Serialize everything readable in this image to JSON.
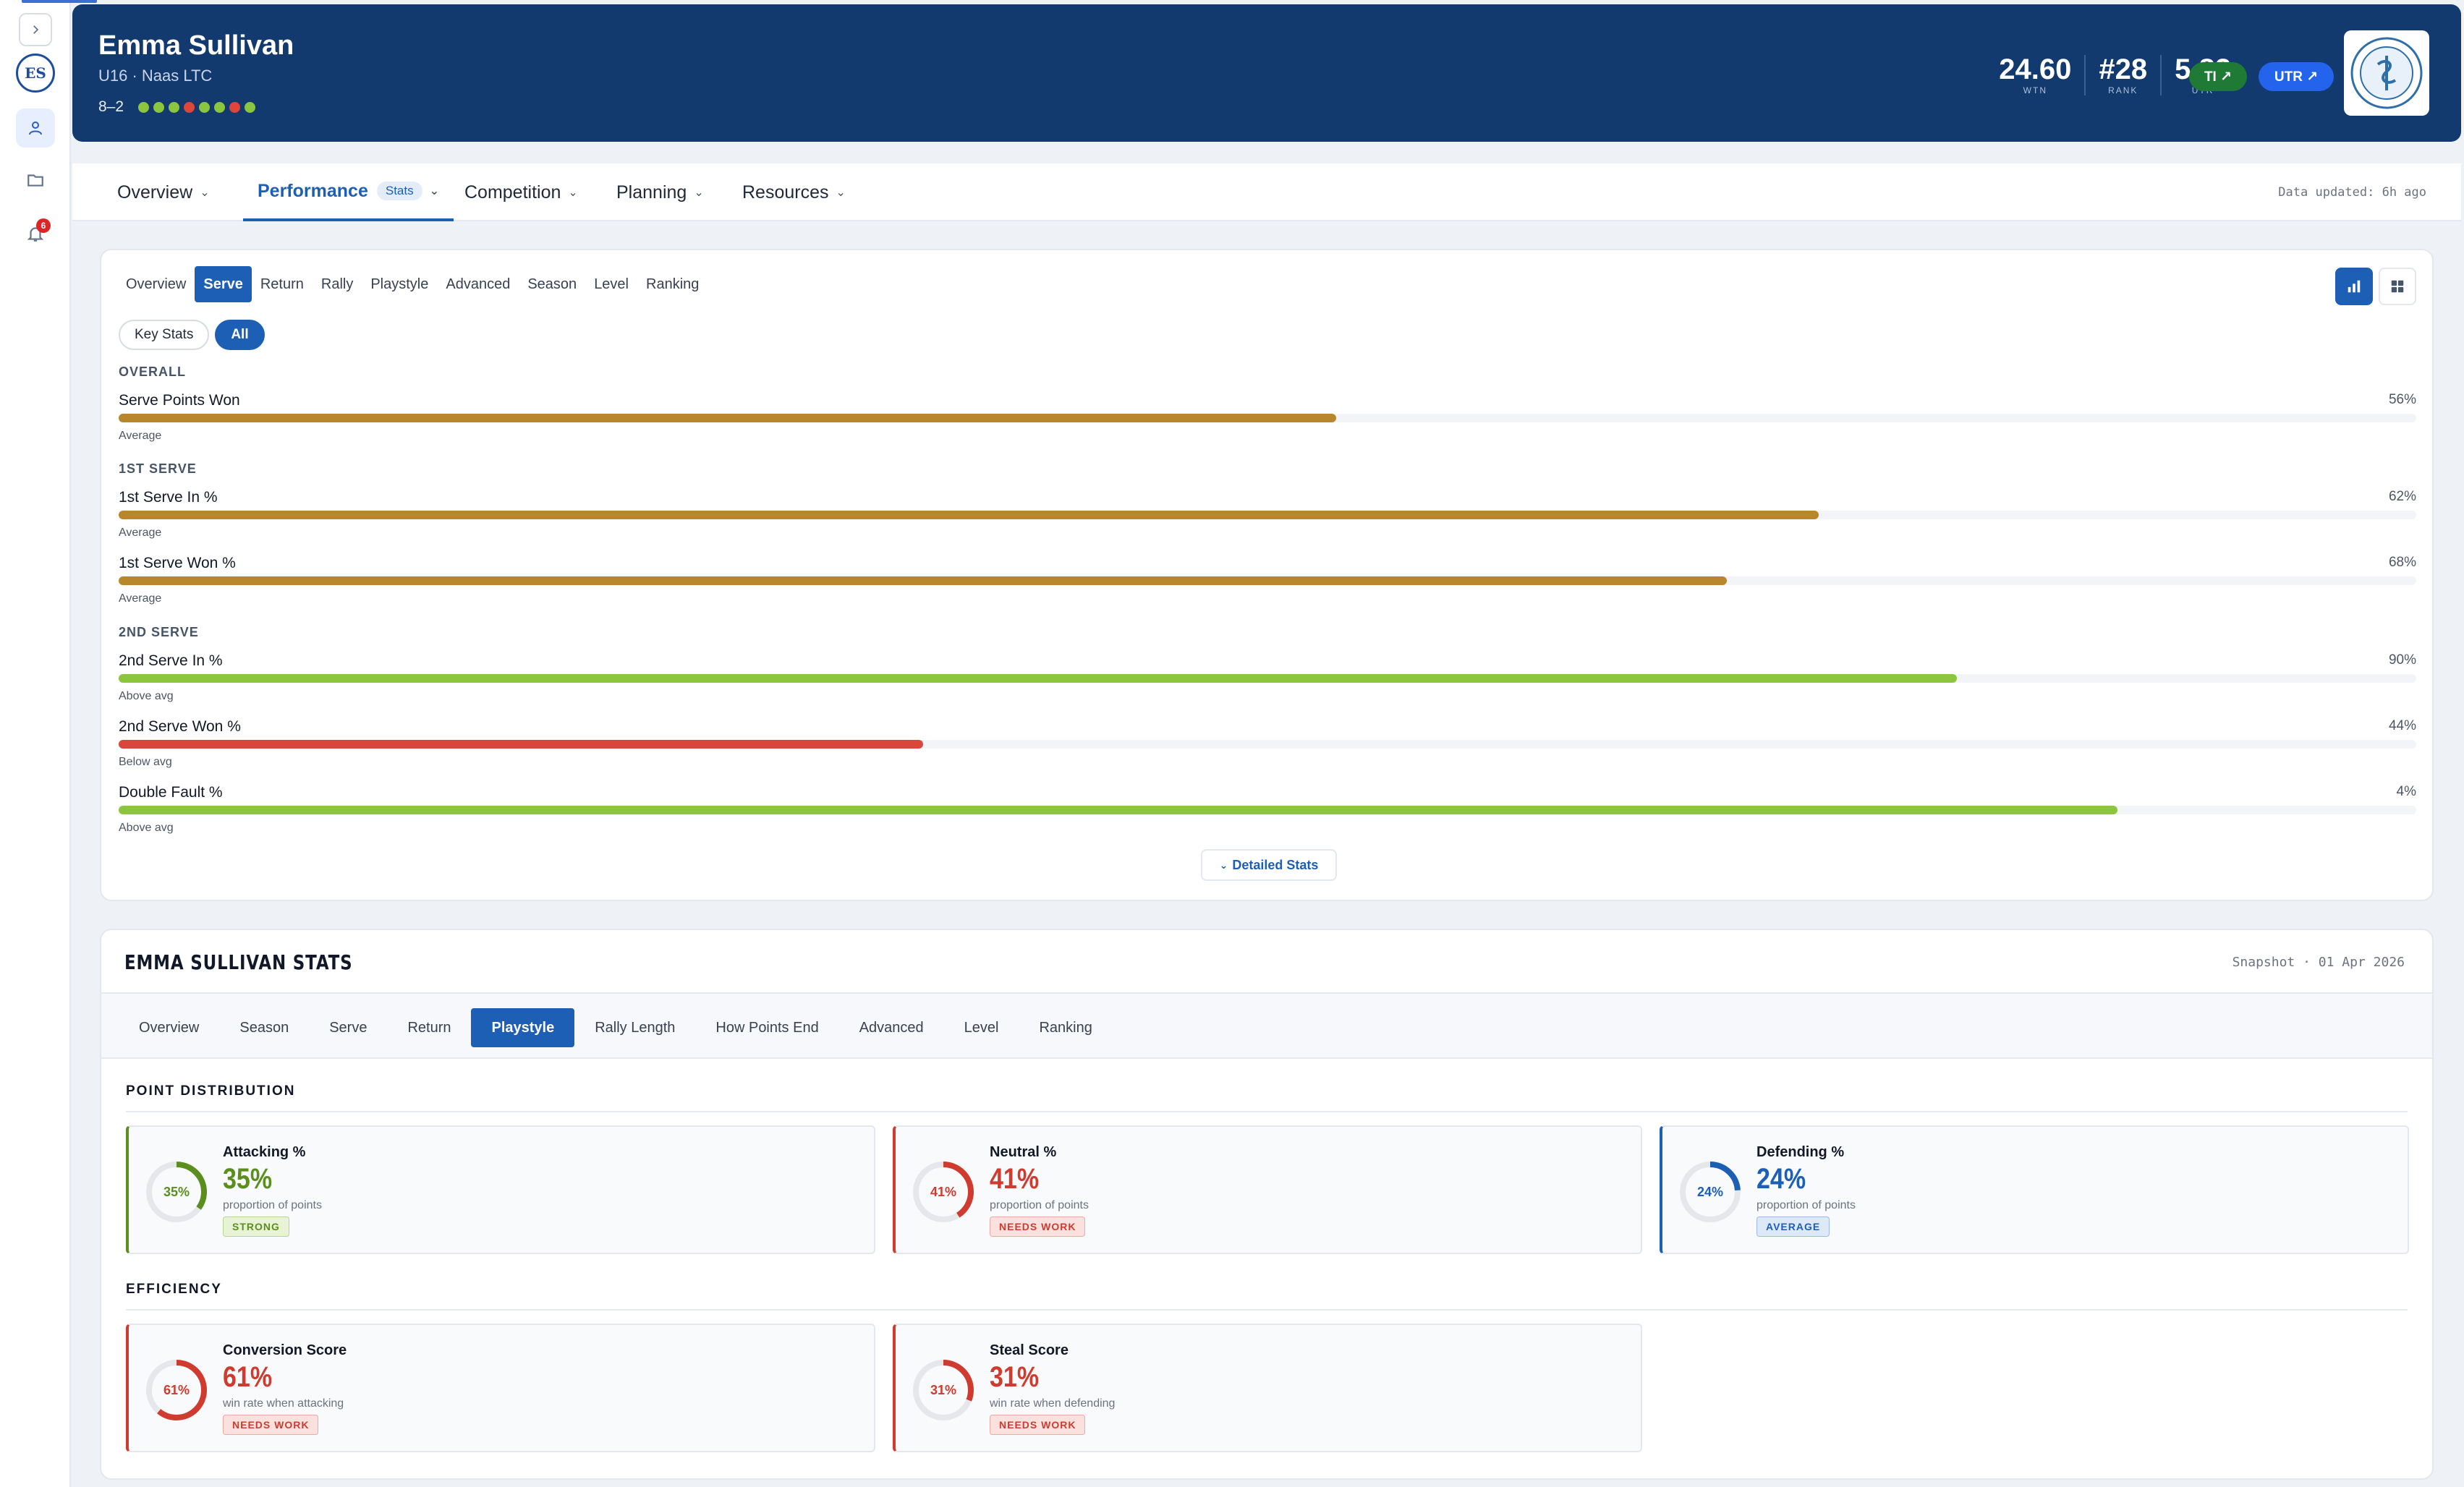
{
  "rail": {
    "avatar_initials": "ES",
    "notification_count": "6"
  },
  "header": {
    "name": "Emma Sullivan",
    "subtitle": "U16 · Naas LTC",
    "record": "8–2",
    "form": [
      "win",
      "win",
      "win",
      "loss",
      "win",
      "win",
      "loss",
      "win"
    ],
    "stats": [
      {
        "value": "24.60",
        "label": "WTN"
      },
      {
        "value": "#28",
        "label": "RANK"
      },
      {
        "value": "5.82",
        "label": "UTR"
      }
    ],
    "ti_label": "TI ↗",
    "utr_label": "UTR ↗"
  },
  "nav": {
    "items": [
      {
        "label": "Overview"
      },
      {
        "label": "Performance",
        "badge": "Stats"
      },
      {
        "label": "Competition"
      },
      {
        "label": "Planning"
      },
      {
        "label": "Resources"
      }
    ],
    "updated": "Data updated: 6h ago"
  },
  "serve_card": {
    "tabs": [
      "Overview",
      "Serve",
      "Return",
      "Rally",
      "Playstyle",
      "Advanced",
      "Season",
      "Level",
      "Ranking"
    ],
    "active_tab": "Serve",
    "segments": [
      "Key Stats",
      "All"
    ],
    "sections": {
      "overall": "OVERALL",
      "first": "1ST SERVE",
      "second": "2ND SERVE"
    },
    "stats": [
      {
        "name": "Serve Points Won",
        "value": "56%",
        "fill": 0.53,
        "note": "Average",
        "color": "#b8862b"
      },
      {
        "name": "1st Serve In %",
        "value": "62%",
        "fill": 0.74,
        "note": "Average",
        "color": "#b8862b"
      },
      {
        "name": "1st Serve Won %",
        "value": "68%",
        "fill": 0.7,
        "note": "Average",
        "color": "#b8862b"
      },
      {
        "name": "2nd Serve In %",
        "value": "90%",
        "fill": 0.8,
        "note": "Above avg",
        "color": "#8cc63f"
      },
      {
        "name": "2nd Serve Won %",
        "value": "44%",
        "fill": 0.35,
        "note": "Below avg",
        "color": "#d9463b"
      },
      {
        "name": "Double Fault %",
        "value": "4%",
        "fill": 0.87,
        "note": "Above avg",
        "color": "#8cc63f"
      }
    ],
    "detailed_label": "Detailed Stats"
  },
  "stats_card": {
    "title": "EMMA SULLIVAN STATS",
    "snapshot": "Snapshot · 01 Apr 2026",
    "tabs": [
      "Overview",
      "Season",
      "Serve",
      "Return",
      "Playstyle",
      "Rally Length",
      "How Points End",
      "Advanced",
      "Level",
      "Ranking"
    ],
    "active_tab": "Playstyle",
    "distribution_head": "POINT DISTRIBUTION",
    "efficiency_head": "EFFICIENCY",
    "distribution": [
      {
        "title": "Attacking %",
        "value": "35%",
        "ring": "35%",
        "pct": 35,
        "sub": "proportion of points",
        "badge": "STRONG",
        "color": "#5a8f1e",
        "badge_bg": "#e8f3d6"
      },
      {
        "title": "Neutral %",
        "value": "41%",
        "ring": "41%",
        "pct": 41,
        "sub": "proportion of points",
        "badge": "NEEDS WORK",
        "color": "#cf3b2e",
        "badge_bg": "#fbe1de"
      },
      {
        "title": "Defending %",
        "value": "24%",
        "ring": "24%",
        "pct": 24,
        "sub": "proportion of points",
        "badge": "AVERAGE",
        "color": "#1d5fb5",
        "badge_bg": "#dde8f8"
      }
    ],
    "efficiency": [
      {
        "title": "Conversion Score",
        "value": "61%",
        "ring": "61%",
        "pct": 61,
        "sub": "win rate when attacking",
        "badge": "NEEDS WORK",
        "color": "#cf3b2e",
        "badge_bg": "#fbe1de"
      },
      {
        "title": "Steal Score",
        "value": "31%",
        "ring": "31%",
        "pct": 31,
        "sub": "win rate when defending",
        "badge": "NEEDS WORK",
        "color": "#cf3b2e",
        "badge_bg": "#fbe1de"
      }
    ]
  }
}
